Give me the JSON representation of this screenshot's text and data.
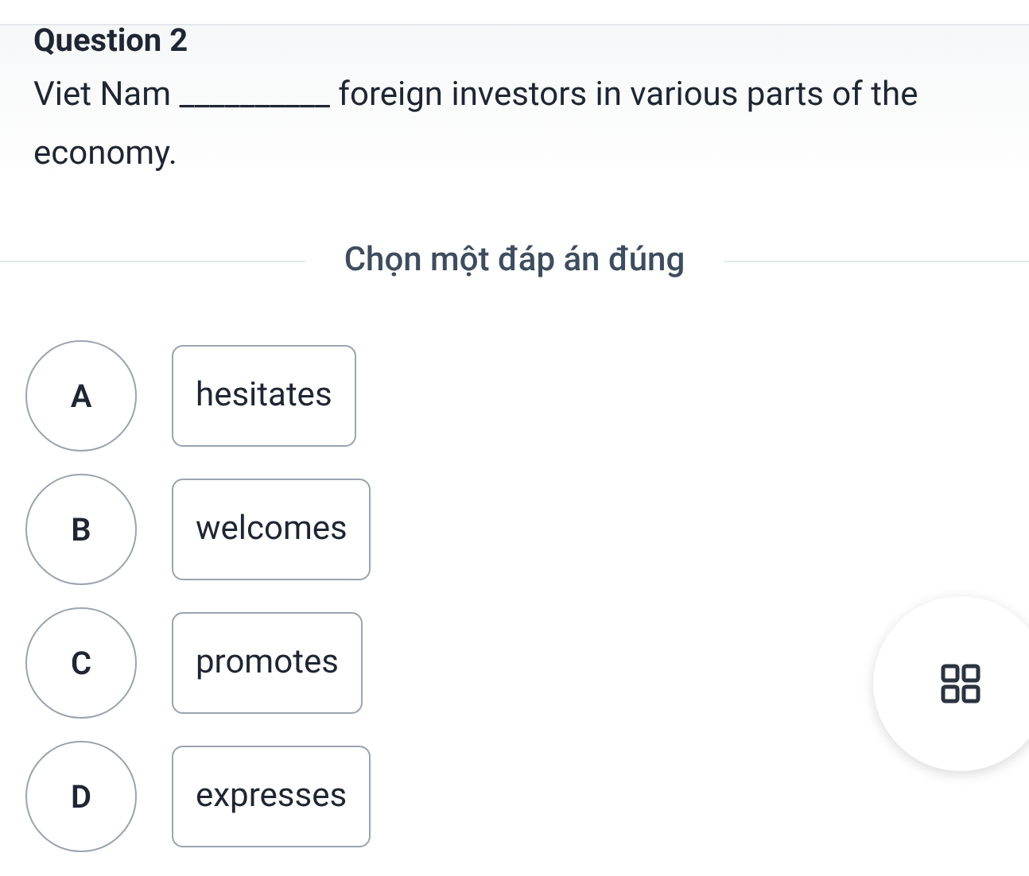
{
  "question": {
    "title": "Question 2",
    "text": "Viet Nam __________ foreign investors in various parts of the economy."
  },
  "instruction": "Chọn một đáp án đúng",
  "options": [
    {
      "letter": "A",
      "text": "hesitates"
    },
    {
      "letter": "B",
      "text": "welcomes"
    },
    {
      "letter": "C",
      "text": "promotes"
    },
    {
      "letter": "D",
      "text": "expresses"
    }
  ]
}
